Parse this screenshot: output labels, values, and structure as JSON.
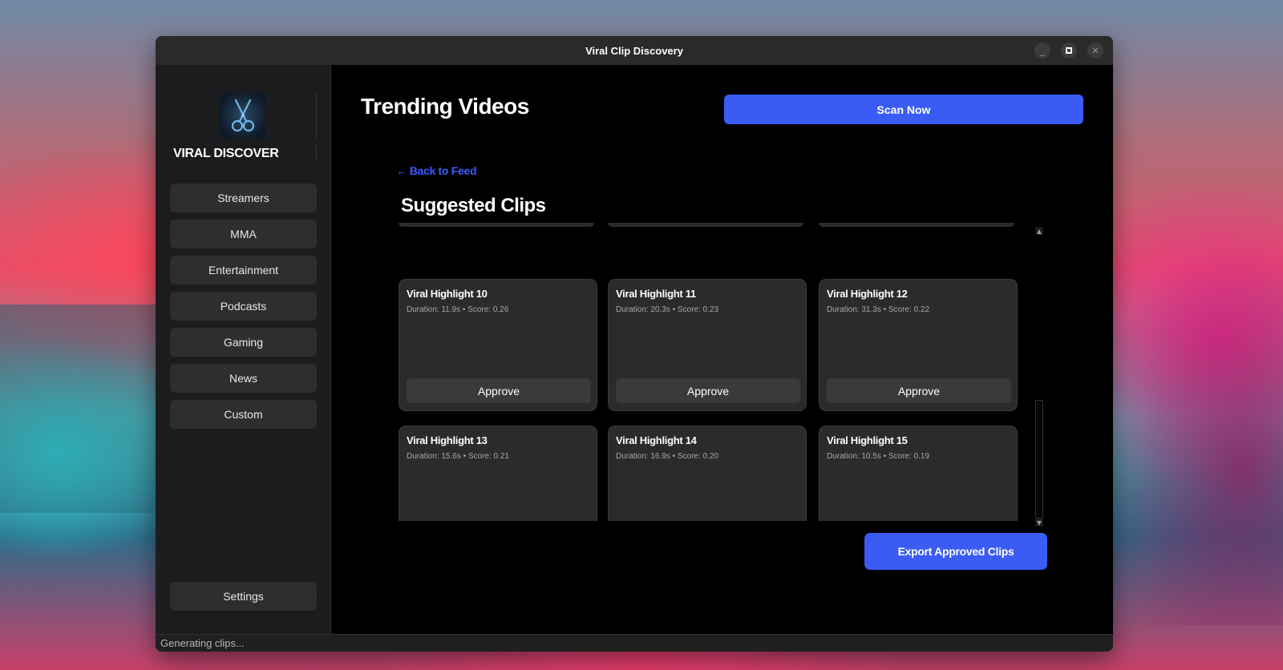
{
  "window": {
    "title": "Viral Clip Discovery",
    "minimize": "_",
    "close": "✕"
  },
  "sidebar": {
    "brand": "VIRAL DISCOVER",
    "logo_icon": "scissors-icon",
    "items": [
      {
        "label": "Streamers"
      },
      {
        "label": "MMA"
      },
      {
        "label": "Entertainment"
      },
      {
        "label": "Podcasts"
      },
      {
        "label": "Gaming"
      },
      {
        "label": "News"
      },
      {
        "label": "Custom"
      }
    ],
    "settings_label": "Settings"
  },
  "header": {
    "title": "Trending Videos",
    "scan_label": "Scan Now"
  },
  "clips_view": {
    "back_arrow": "←",
    "back_label": "Back to Feed",
    "section_title": "Suggested Clips",
    "approve_label": "Approve",
    "clips": [
      {
        "title": "Viral Highlight 10",
        "meta": "Duration: 11.9s • Score: 0.26"
      },
      {
        "title": "Viral Highlight 11",
        "meta": "Duration: 20.3s • Score: 0.23"
      },
      {
        "title": "Viral Highlight 12",
        "meta": "Duration: 31.3s • Score: 0.22"
      },
      {
        "title": "Viral Highlight 13",
        "meta": "Duration: 15.6s • Score: 0.21"
      },
      {
        "title": "Viral Highlight 14",
        "meta": "Duration: 16.9s • Score: 0.20"
      },
      {
        "title": "Viral Highlight 15",
        "meta": "Duration: 10.5s • Score: 0.19"
      }
    ],
    "export_label": "Export Approved Clips"
  },
  "status": {
    "text": "Generating clips..."
  },
  "colors": {
    "accent": "#3a5cf5",
    "link": "#3d5cff",
    "card_bg": "#2b2b2d",
    "sidebar_bg": "#1c1c1e"
  }
}
